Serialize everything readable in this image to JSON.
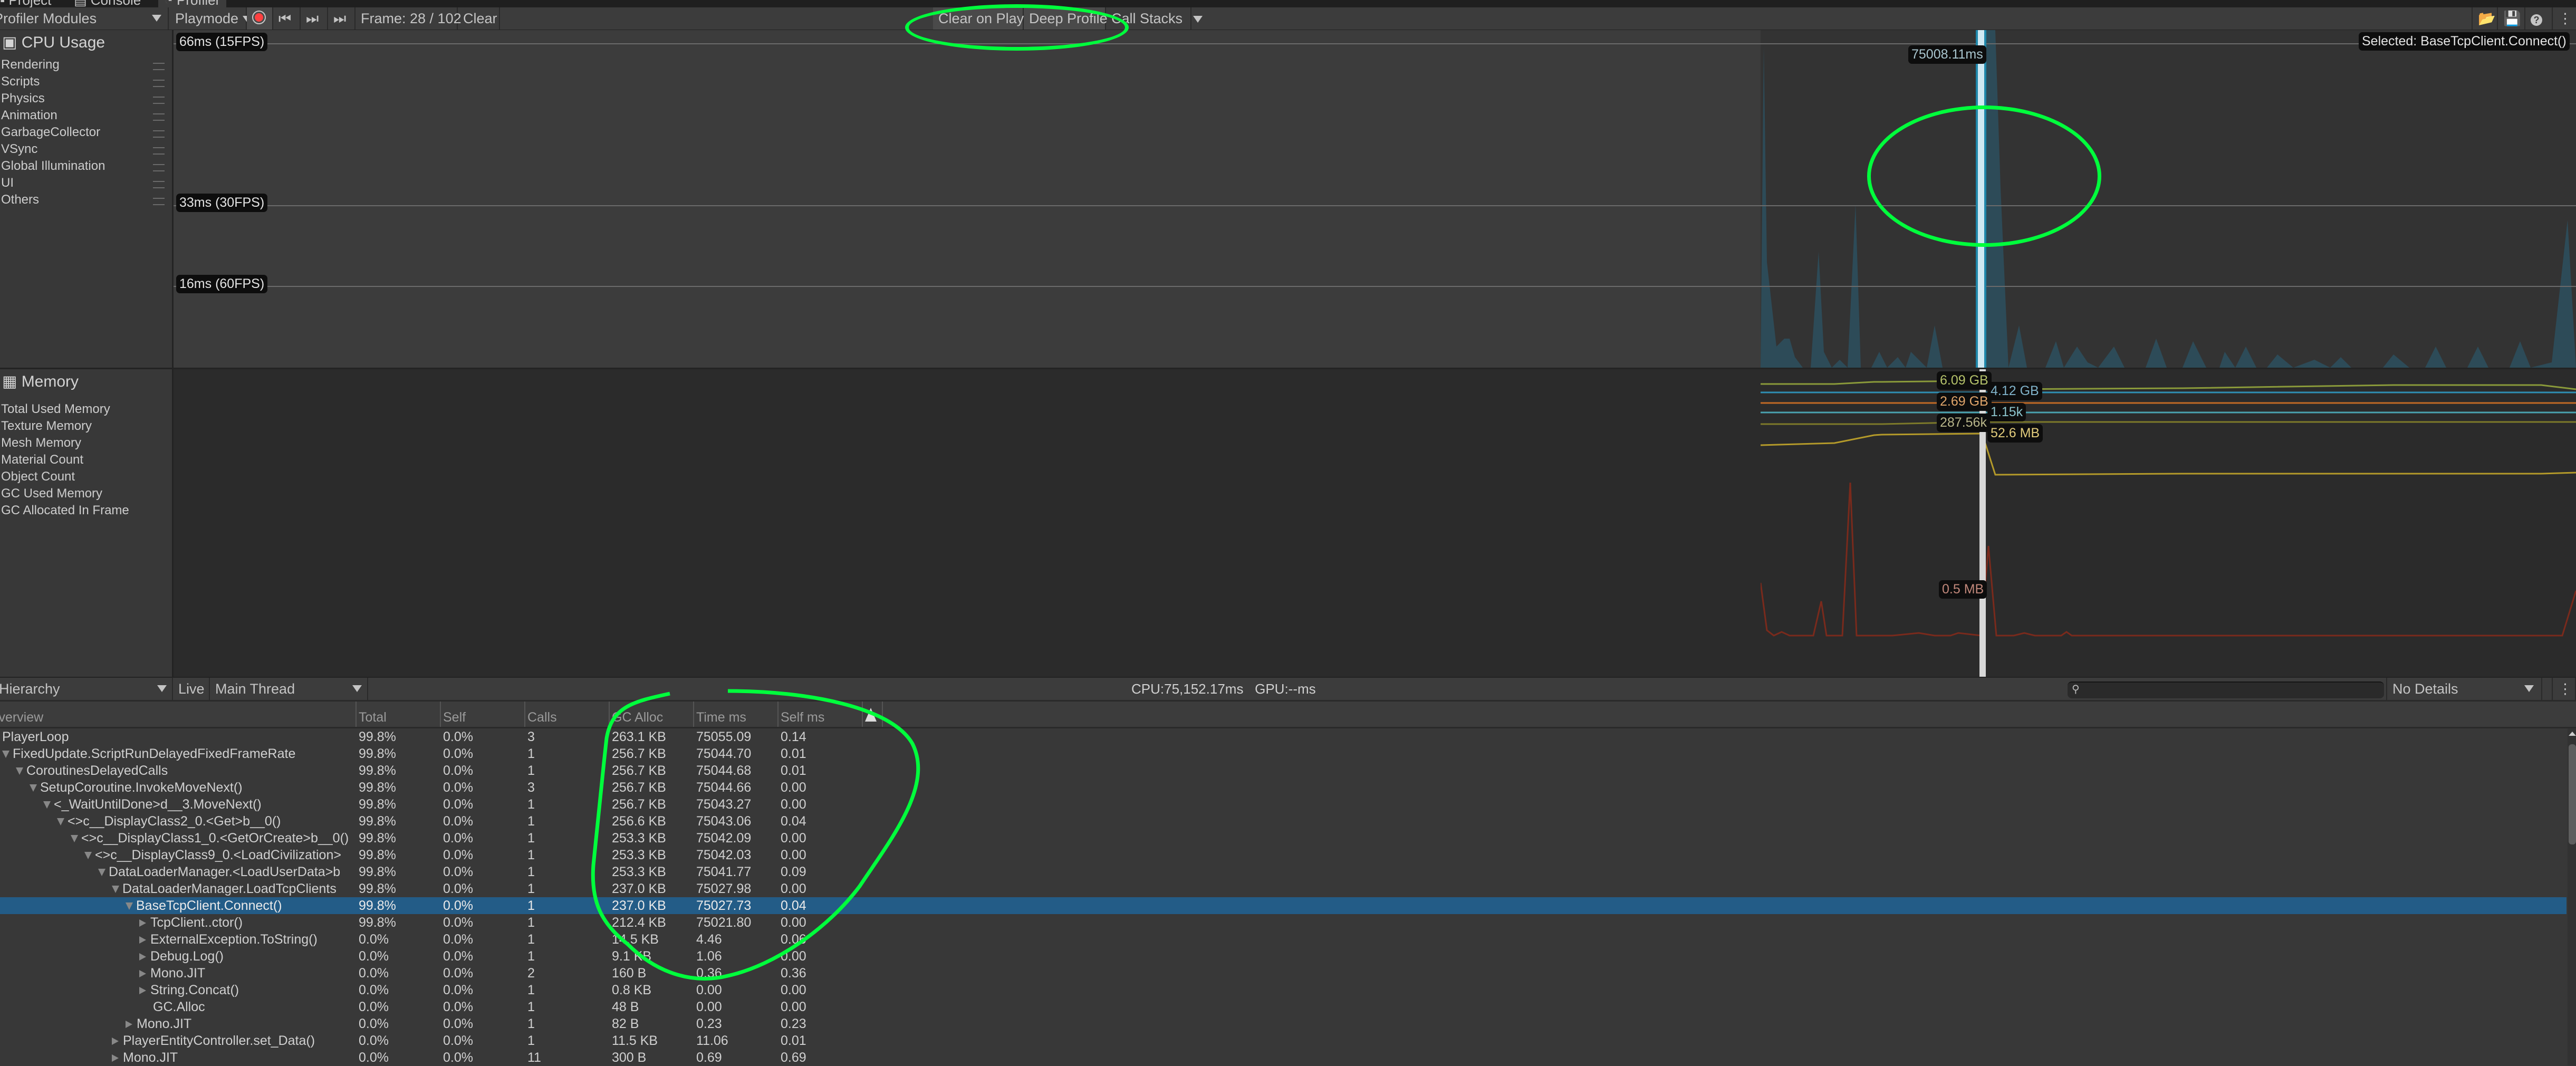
{
  "tabs": [
    {
      "label": "Project",
      "icon": "folder-icon"
    },
    {
      "label": "Console",
      "icon": "console-icon"
    },
    {
      "label": "Profiler",
      "icon": "profiler-icon",
      "active": true
    }
  ],
  "toolbar": {
    "modules_dropdown": "Profiler Modules",
    "target_dropdown": "Playmode",
    "record_icon": "record-icon",
    "prev_frame_icon": "step-back-icon",
    "next_frame_icon": "step-forward-icon",
    "last_frame_icon": "skip-to-end-icon",
    "frame_label": "Frame: 28 / 102",
    "clear": "Clear",
    "clear_on_play": "Clear on Play",
    "deep_profile": "Deep Profile",
    "call_stacks": "Call Stacks",
    "load_icon": "load-icon",
    "save_icon": "save-icon",
    "help_icon": "help-icon",
    "menu_icon": "kebab-menu-icon"
  },
  "cpu_module": {
    "title": "CPU Usage",
    "legend": [
      "Rendering",
      "Scripts",
      "Physics",
      "Animation",
      "GarbageCollector",
      "VSync",
      "Global Illumination",
      "UI",
      "Others"
    ],
    "grid_labels": [
      "66ms (15FPS)",
      "33ms (30FPS)",
      "16ms (60FPS)"
    ],
    "selected_frame_value": "75008.11ms",
    "selected_label": "Selected: BaseTcpClient.Connect()"
  },
  "memory_module": {
    "title": "Memory",
    "legend": [
      "Total Used Memory",
      "Texture Memory",
      "Mesh Memory",
      "Material Count",
      "Object Count",
      "GC Used Memory",
      "GC Allocated In Frame"
    ],
    "values": [
      {
        "label": "6.09 GB",
        "color": "#b5c26a"
      },
      {
        "label": "4.12 GB",
        "color": "#7fb1c8"
      },
      {
        "label": "2.69 GB",
        "color": "#e0a56a"
      },
      {
        "label": "1.15k",
        "color": "#8cc4cc"
      },
      {
        "label": "287.56k",
        "color": "#b8b58a"
      },
      {
        "label": "52.6 MB",
        "color": "#e2cc7c"
      },
      {
        "label": "0.5 MB",
        "color": "#c0877a"
      }
    ]
  },
  "hierarchy_toolbar": {
    "view_dropdown": "Hierarchy",
    "live": "Live",
    "thread_dropdown": "Main Thread",
    "stats": "CPU:75,152.17ms   GPU:--ms",
    "search_placeholder": "",
    "details_dropdown": "No Details"
  },
  "table": {
    "columns": [
      "Overview",
      "Total",
      "Self",
      "Calls",
      "GC Alloc",
      "Time ms",
      "Self ms"
    ],
    "warning_icon": "warning-icon",
    "rows": [
      {
        "name": "PlayerLoop",
        "depth": 0,
        "expander": "none",
        "total": "99.8%",
        "self": "0.0%",
        "calls": "3",
        "gc": "263.1 KB",
        "time": "75055.09",
        "selfms": "0.14"
      },
      {
        "name": "FixedUpdate.ScriptRunDelayedFixedFrameRate",
        "depth": 0,
        "expander": "open",
        "total": "99.8%",
        "self": "0.0%",
        "calls": "1",
        "gc": "256.7 KB",
        "time": "75044.70",
        "selfms": "0.01"
      },
      {
        "name": "CoroutinesDelayedCalls",
        "depth": 1,
        "expander": "open",
        "total": "99.8%",
        "self": "0.0%",
        "calls": "1",
        "gc": "256.7 KB",
        "time": "75044.68",
        "selfms": "0.01"
      },
      {
        "name": "SetupCoroutine.InvokeMoveNext()",
        "depth": 2,
        "expander": "open",
        "total": "99.8%",
        "self": "0.0%",
        "calls": "3",
        "gc": "256.7 KB",
        "time": "75044.66",
        "selfms": "0.00"
      },
      {
        "name": "<_WaitUntilDone>d__3.MoveNext()",
        "depth": 3,
        "expander": "open",
        "total": "99.8%",
        "self": "0.0%",
        "calls": "1",
        "gc": "256.7 KB",
        "time": "75043.27",
        "selfms": "0.00"
      },
      {
        "name": "<>c__DisplayClass2_0.<Get>b__0()",
        "depth": 4,
        "expander": "open",
        "total": "99.8%",
        "self": "0.0%",
        "calls": "1",
        "gc": "256.6 KB",
        "time": "75043.06",
        "selfms": "0.04"
      },
      {
        "name": "<>c__DisplayClass1_0.<GetOrCreate>b__0()",
        "depth": 5,
        "expander": "open",
        "total": "99.8%",
        "self": "0.0%",
        "calls": "1",
        "gc": "253.3 KB",
        "time": "75042.09",
        "selfms": "0.00"
      },
      {
        "name": "<>c__DisplayClass9_0.<LoadCivilization>",
        "depth": 6,
        "expander": "open",
        "total": "99.8%",
        "self": "0.0%",
        "calls": "1",
        "gc": "253.3 KB",
        "time": "75042.03",
        "selfms": "0.00"
      },
      {
        "name": "DataLoaderManager.<LoadUserData>b",
        "depth": 7,
        "expander": "open",
        "total": "99.8%",
        "self": "0.0%",
        "calls": "1",
        "gc": "253.3 KB",
        "time": "75041.77",
        "selfms": "0.09"
      },
      {
        "name": "DataLoaderManager.LoadTcpClients",
        "depth": 8,
        "expander": "open",
        "total": "99.8%",
        "self": "0.0%",
        "calls": "1",
        "gc": "237.0 KB",
        "time": "75027.98",
        "selfms": "0.00"
      },
      {
        "name": "BaseTcpClient.Connect()",
        "depth": 9,
        "expander": "open",
        "selected": true,
        "total": "99.8%",
        "self": "0.0%",
        "calls": "1",
        "gc": "237.0 KB",
        "time": "75027.73",
        "selfms": "0.04"
      },
      {
        "name": "TcpClient..ctor()",
        "depth": 10,
        "expander": "closed",
        "total": "99.8%",
        "self": "0.0%",
        "calls": "1",
        "gc": "212.4 KB",
        "time": "75021.80",
        "selfms": "0.00"
      },
      {
        "name": "ExternalException.ToString()",
        "depth": 10,
        "expander": "closed",
        "total": "0.0%",
        "self": "0.0%",
        "calls": "1",
        "gc": "14.5 KB",
        "time": "4.46",
        "selfms": "0.06"
      },
      {
        "name": "Debug.Log()",
        "depth": 10,
        "expander": "closed",
        "total": "0.0%",
        "self": "0.0%",
        "calls": "1",
        "gc": "9.1 KB",
        "time": "1.06",
        "selfms": "0.00"
      },
      {
        "name": "Mono.JIT",
        "depth": 10,
        "expander": "closed",
        "total": "0.0%",
        "self": "0.0%",
        "calls": "2",
        "gc": "160 B",
        "time": "0.36",
        "selfms": "0.36"
      },
      {
        "name": "String.Concat()",
        "depth": 10,
        "expander": "closed",
        "total": "0.0%",
        "self": "0.0%",
        "calls": "1",
        "gc": "0.8 KB",
        "time": "0.00",
        "selfms": "0.00"
      },
      {
        "name": "GC.Alloc",
        "depth": 10,
        "expander": "none",
        "total": "0.0%",
        "self": "0.0%",
        "calls": "1",
        "gc": "48 B",
        "time": "0.00",
        "selfms": "0.00"
      },
      {
        "name": "Mono.JIT",
        "depth": 9,
        "expander": "closed",
        "total": "0.0%",
        "self": "0.0%",
        "calls": "1",
        "gc": "82 B",
        "time": "0.23",
        "selfms": "0.23"
      },
      {
        "name": "PlayerEntityController.set_Data()",
        "depth": 8,
        "expander": "closed",
        "total": "0.0%",
        "self": "0.0%",
        "calls": "1",
        "gc": "11.5 KB",
        "time": "11.06",
        "selfms": "0.01"
      },
      {
        "name": "Mono.JIT",
        "depth": 8,
        "expander": "closed",
        "total": "0.0%",
        "self": "0.0%",
        "calls": "11",
        "gc": "300 B",
        "time": "0.69",
        "selfms": "0.69"
      }
    ]
  },
  "colors": {
    "accent_selected_row": "#235c87",
    "selected_frame": "#4fb3d9",
    "cpu_area": "#2d4b58",
    "record": "#ff4040",
    "annotation": "#00ff3c"
  }
}
